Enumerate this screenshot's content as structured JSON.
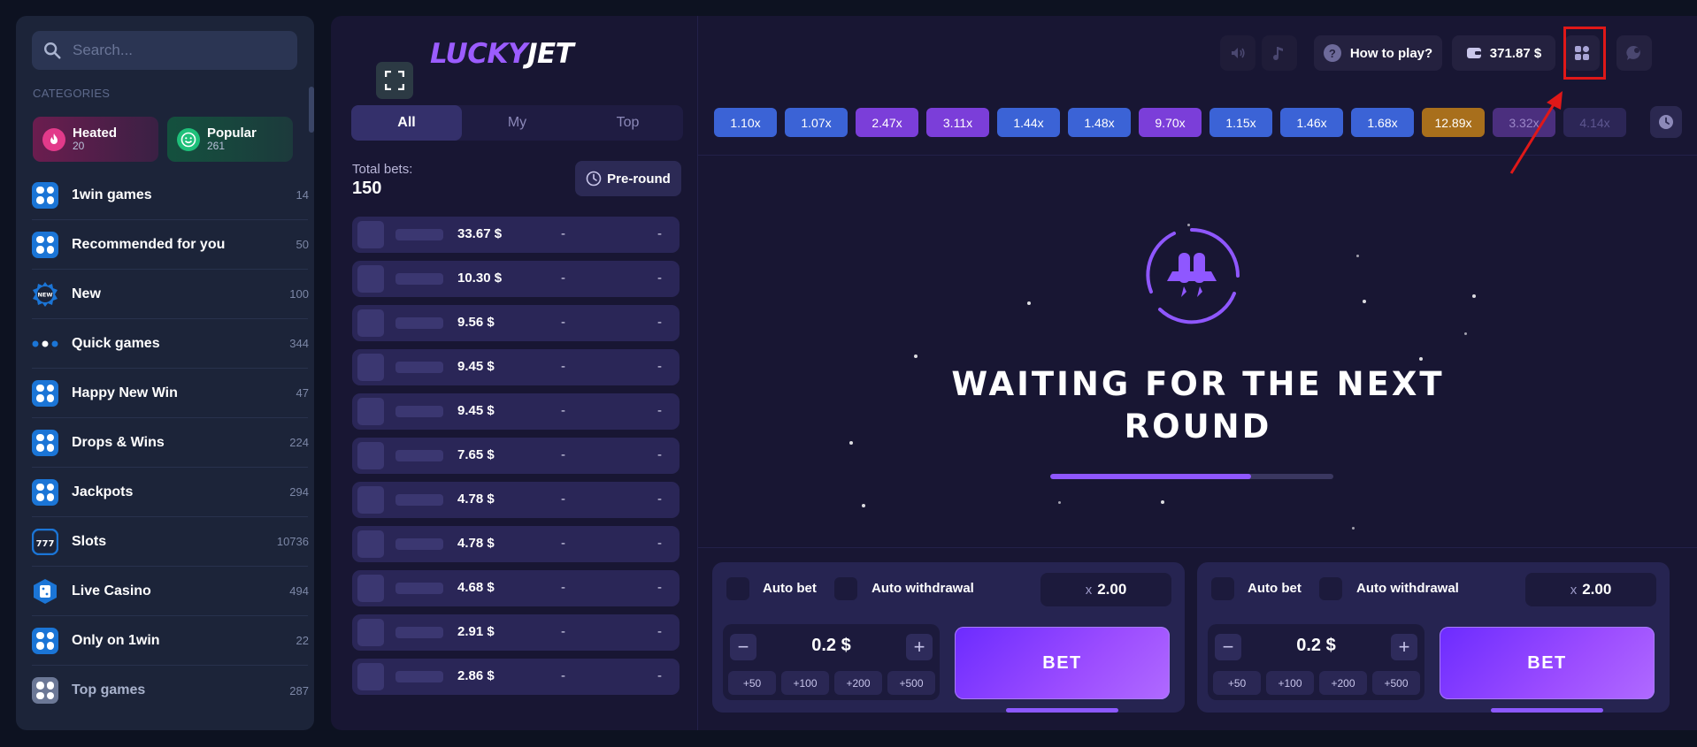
{
  "search": {
    "placeholder": "Search..."
  },
  "categories_title": "CATEGORIES",
  "chips": [
    {
      "label": "Heated",
      "count": "20"
    },
    {
      "label": "Popular",
      "count": "261"
    }
  ],
  "nav": [
    {
      "label": "1win games",
      "count": "14",
      "icon": "grid-icon"
    },
    {
      "label": "Recommended for you",
      "count": "50",
      "icon": "grid-icon"
    },
    {
      "label": "New",
      "count": "100",
      "icon": "new-badge-icon"
    },
    {
      "label": "Quick games",
      "count": "344",
      "icon": "dots-icon"
    },
    {
      "label": "Happy New Win",
      "count": "47",
      "icon": "grid-icon"
    },
    {
      "label": "Drops & Wins",
      "count": "224",
      "icon": "grid-icon"
    },
    {
      "label": "Jackpots",
      "count": "294",
      "icon": "grid-icon"
    },
    {
      "label": "Slots",
      "count": "10736",
      "icon": "slots-icon"
    },
    {
      "label": "Live Casino",
      "count": "494",
      "icon": "live-casino-icon"
    },
    {
      "label": "Only on 1win",
      "count": "22",
      "icon": "grid-icon"
    },
    {
      "label": "Top games",
      "count": "287",
      "icon": "grid-icon"
    }
  ],
  "game": {
    "logo_a": "LUCKY",
    "logo_b": "JET",
    "tabs": [
      "All",
      "My",
      "Top"
    ],
    "total_bets_label": "Total bets:",
    "total_bets_value": "150",
    "preround_label": "Pre-round",
    "bets": [
      {
        "amount": "33.67 $",
        "coef": "-",
        "win": "-"
      },
      {
        "amount": "10.30 $",
        "coef": "-",
        "win": "-"
      },
      {
        "amount": "9.56 $",
        "coef": "-",
        "win": "-"
      },
      {
        "amount": "9.45 $",
        "coef": "-",
        "win": "-"
      },
      {
        "amount": "9.45 $",
        "coef": "-",
        "win": "-"
      },
      {
        "amount": "7.65 $",
        "coef": "-",
        "win": "-"
      },
      {
        "amount": "4.78 $",
        "coef": "-",
        "win": "-"
      },
      {
        "amount": "4.78 $",
        "coef": "-",
        "win": "-"
      },
      {
        "amount": "4.68 $",
        "coef": "-",
        "win": "-"
      },
      {
        "amount": "2.91 $",
        "coef": "-",
        "win": "-"
      },
      {
        "amount": "2.86 $",
        "coef": "-",
        "win": "-"
      }
    ],
    "how_to_play": "How to play?",
    "how_to_play_icon": "?",
    "balance": "371.87 $",
    "coefficients": [
      {
        "value": "1.10x",
        "color": "#3b63d6"
      },
      {
        "value": "1.07x",
        "color": "#3b63d6"
      },
      {
        "value": "2.47x",
        "color": "#7b3ed9"
      },
      {
        "value": "3.11x",
        "color": "#7b3ed9"
      },
      {
        "value": "1.44x",
        "color": "#3b63d6"
      },
      {
        "value": "1.48x",
        "color": "#3b63d6"
      },
      {
        "value": "9.70x",
        "color": "#7b3ed9"
      },
      {
        "value": "1.15x",
        "color": "#3b63d6"
      },
      {
        "value": "1.46x",
        "color": "#3b63d6"
      },
      {
        "value": "1.68x",
        "color": "#3b63d6"
      },
      {
        "value": "12.89x",
        "color": "#a86f1c"
      },
      {
        "value": "3.32x",
        "color": "#4b2f7e"
      },
      {
        "value": "4.14x",
        "color": "#2c2656"
      }
    ],
    "waiting_text": "WAITING FOR THE NEXT ROUND",
    "progress": 0.71,
    "panels": [
      {
        "auto_bet": "Auto bet",
        "auto_withdrawal": "Auto withdrawal",
        "mult_prefix": "x",
        "mult_value": "2.00",
        "amount": "0.2 $",
        "minus": "−",
        "plus": "+",
        "quick": [
          "+50",
          "+100",
          "+200",
          "+500"
        ],
        "bet_label": "BET"
      },
      {
        "auto_bet": "Auto bet",
        "auto_withdrawal": "Auto withdrawal",
        "mult_prefix": "x",
        "mult_value": "2.00",
        "amount": "0.2 $",
        "minus": "−",
        "plus": "+",
        "quick": [
          "+50",
          "+100",
          "+200",
          "+500"
        ],
        "bet_label": "BET"
      }
    ]
  },
  "colors": {
    "accent": "#8f57ff",
    "sidebar_bg": "#1c2439",
    "game_bg": "#181633",
    "highlight": "#e01818"
  }
}
